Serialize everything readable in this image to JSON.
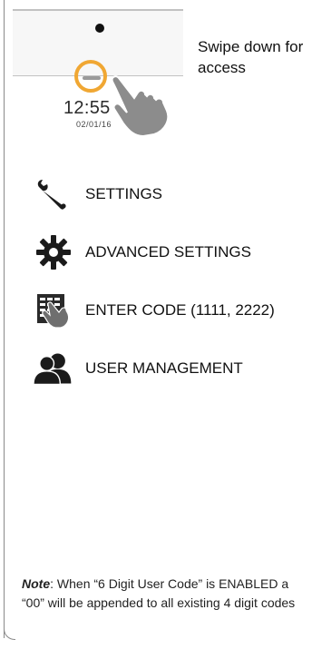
{
  "illustration": {
    "clock_time": "12:55",
    "clock_date": "02/01/16",
    "swipe_caption": "Swipe down for access"
  },
  "menu": [
    {
      "label": "SETTINGS",
      "icon": "wrench-icon"
    },
    {
      "label": "ADVANCED SETTINGS",
      "icon": "gear-icon"
    },
    {
      "label": "ENTER CODE (1111, 2222)",
      "icon": "keypad-hand-icon"
    },
    {
      "label": "USER MANAGEMENT",
      "icon": "users-icon"
    }
  ],
  "note": {
    "label": "Note",
    "text": ":  When “6 Digit User Code” is ENABLED a “00” will be appended to all existing 4 digit codes"
  },
  "colors": {
    "accent_ring": "#f0a733",
    "icon_dark": "#1b1b1b",
    "hand_gray": "#8c8c8c"
  }
}
